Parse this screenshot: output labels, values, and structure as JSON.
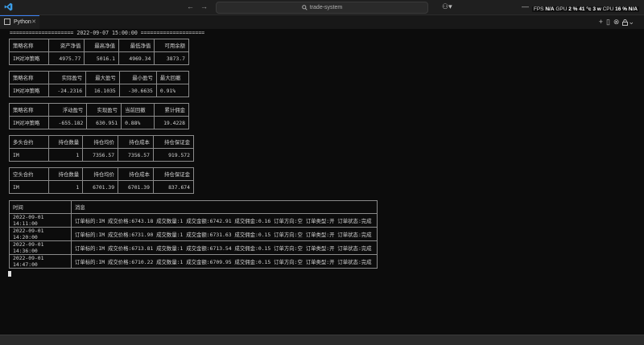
{
  "window": {
    "search_text": "trade-system",
    "perf": {
      "fps_label": "FPS",
      "fps_value": "N/A",
      "gpu_label": "GPU",
      "gpu_value": "2 %  41 °c  3 w",
      "cpu_label": "CPU",
      "cpu_value": "16 %",
      "extra": "N/A"
    }
  },
  "tab": {
    "label": "Python"
  },
  "terminal": {
    "header_line": "==================== 2022-09-07 15:00:00 ====================",
    "table1": {
      "headers": [
        "策略名称",
        "资产净值",
        "最高净值",
        "最低净值",
        "可用余额"
      ],
      "row": [
        "IM对冲策略",
        "4975.77",
        "5016.1",
        "4969.34",
        "3873.7"
      ]
    },
    "table2": {
      "headers": [
        "策略名称",
        "实际盈亏",
        "最大盈亏",
        "最小盈亏",
        "最大回撤"
      ],
      "row": [
        "IM对冲策略",
        "-24.2316",
        "16.1035",
        "-30.6635",
        "0.91%"
      ]
    },
    "table3": {
      "headers": [
        "策略名称",
        "浮动盈亏",
        "实现盈亏",
        "当前回撤",
        "累计佣金"
      ],
      "row": [
        "IM对冲策略",
        "-655.182",
        "630.951",
        "0.88%",
        "19.4228"
      ]
    },
    "table4": {
      "headers": [
        "多头合约",
        "持仓数量",
        "持仓均价",
        "持仓成本",
        "持仓保证金"
      ],
      "row": [
        "IM",
        "1",
        "7356.57",
        "7356.57",
        "919.572"
      ]
    },
    "table5": {
      "headers": [
        "空头合约",
        "持仓数量",
        "持仓均价",
        "持仓成本",
        "持仓保证金"
      ],
      "row": [
        "IM",
        "1",
        "6701.39",
        "6701.39",
        "837.674"
      ]
    },
    "log": {
      "headers": [
        "时间",
        "消息"
      ],
      "rows": [
        [
          "2022-09-01 14:11:00",
          "订单标的:IM 成交价格:6743.18 成交数量:1 成交金额:6742.91 成交佣金:0.16 订单方向:空 订单类型:开 订单状态:完成"
        ],
        [
          "2022-09-01 14:20:00",
          "订单标的:IM 成交价格:6731.90 成交数量:1 成交金额:6731.63 成交佣金:0.15 订单方向:空 订单类型:开 订单状态:完成"
        ],
        [
          "2022-09-01 14:36:00",
          "订单标的:IM 成交价格:6713.81 成交数量:1 成交金额:6713.54 成交佣金:0.15 订单方向:空 订单类型:开 订单状态:完成"
        ],
        [
          "2022-09-01 14:47:00",
          "订单标的:IM 成交价格:6710.22 成交数量:1 成交金额:6709.95 成交佣金:0.15 订单方向:空 订单类型:开 订单状态:完成"
        ]
      ]
    }
  }
}
